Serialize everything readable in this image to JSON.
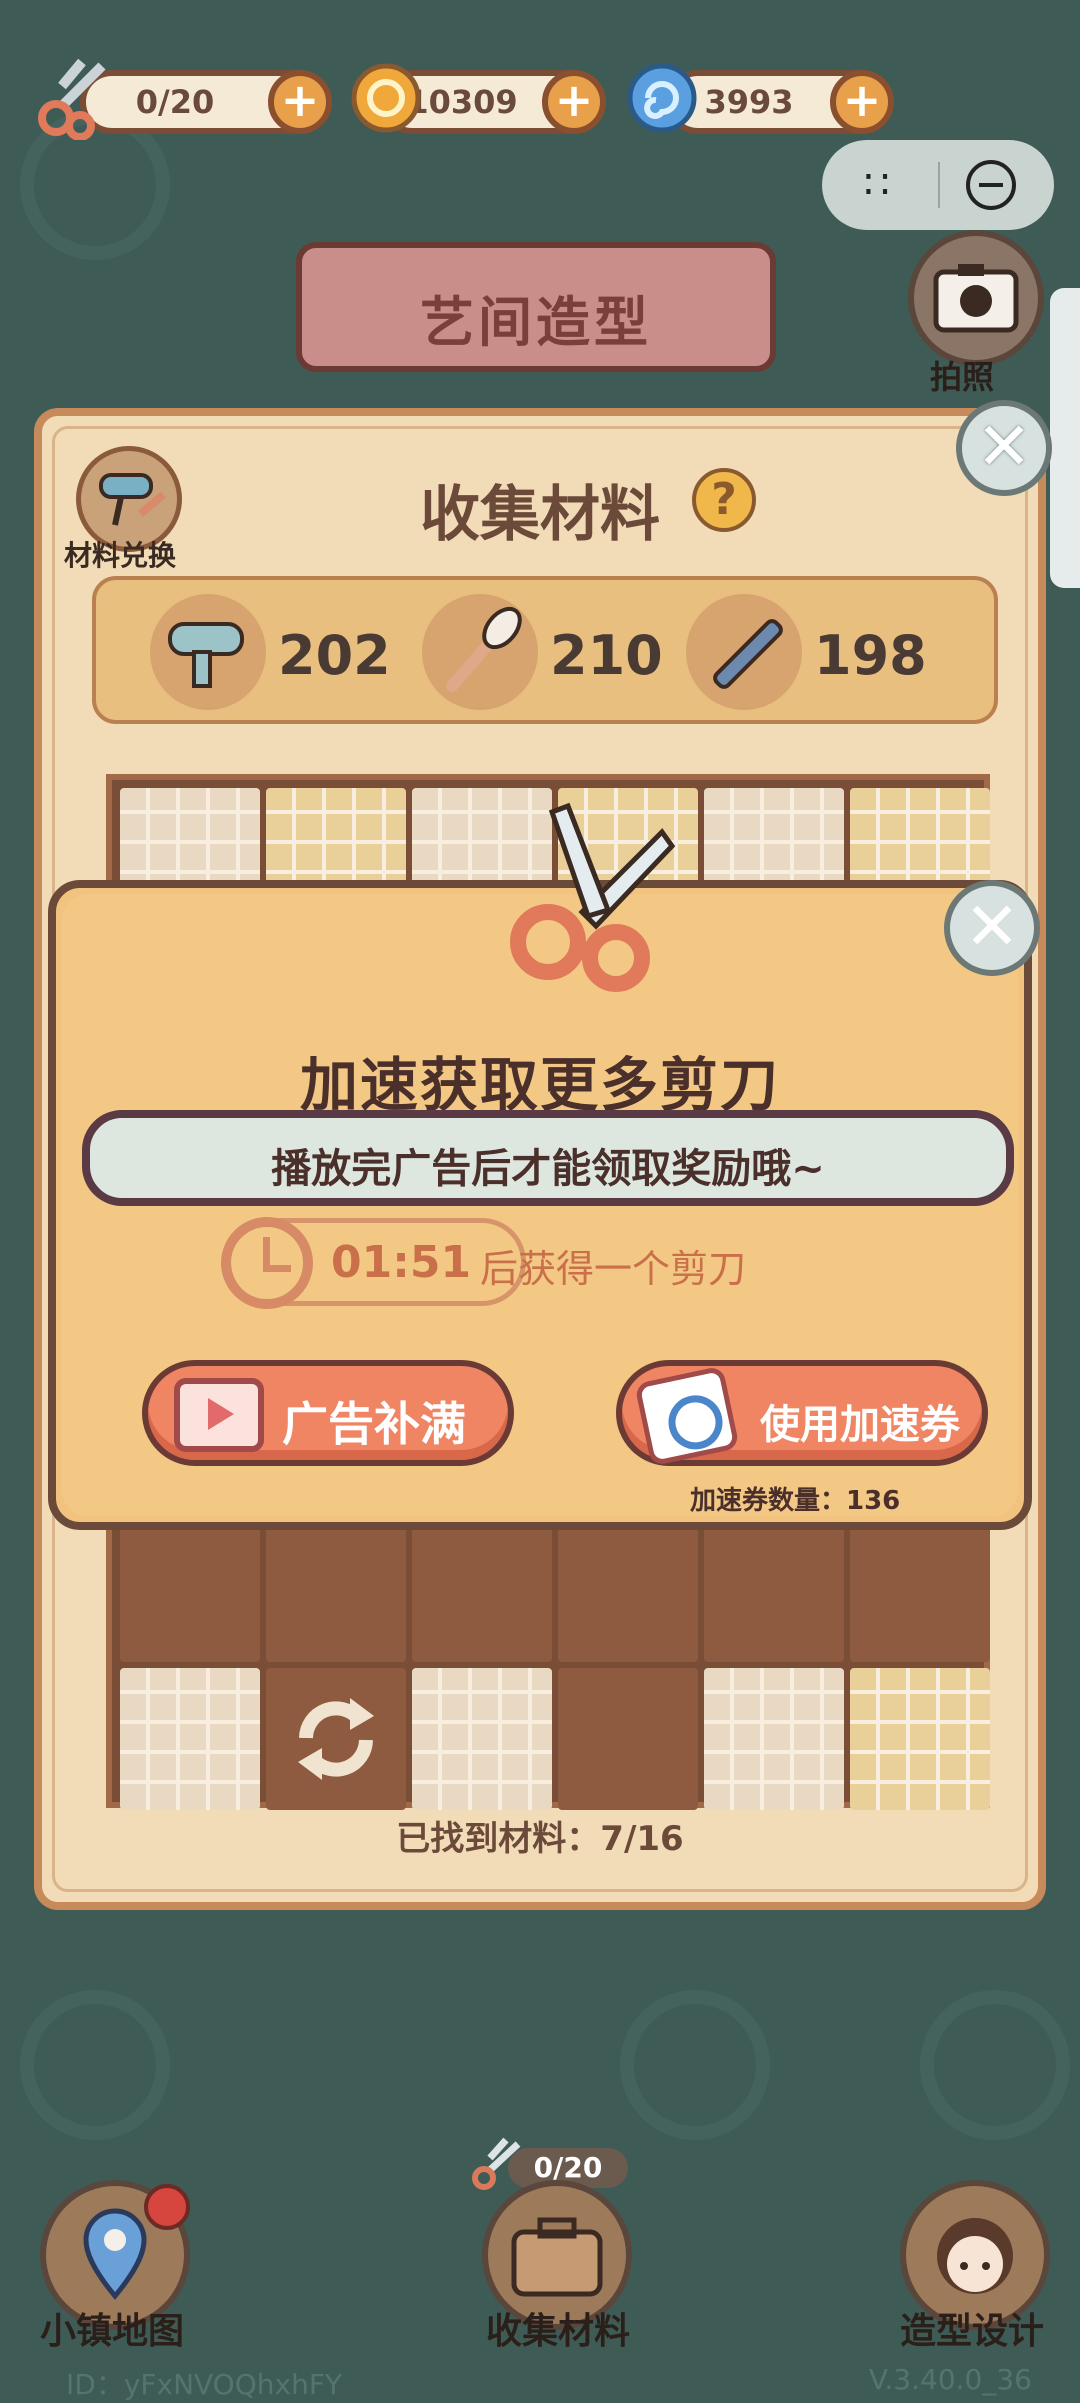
{
  "resources": [
    {
      "value": "0/20",
      "icon": "scissors-icon"
    },
    {
      "value": "10309",
      "icon": "coin-icon"
    },
    {
      "value": "3993",
      "icon": "swirl-gem-icon"
    }
  ],
  "banner": {
    "title": "艺间造型"
  },
  "camera": {
    "label": "拍照"
  },
  "panel": {
    "title": "收集材料",
    "exchange_label": "材料兑换",
    "materials": [
      {
        "icon": "hair-dryer-icon",
        "count": "202"
      },
      {
        "icon": "makeup-brush-icon",
        "count": "210"
      },
      {
        "icon": "comb-icon",
        "count": "198"
      }
    ],
    "found_text": "已找到材料：7/16"
  },
  "dialog": {
    "title": "加速获取更多剪刀",
    "notice": "播放完广告后才能领取奖励哦~",
    "timer": "01:51",
    "timer_suffix": "后获得一个剪刀",
    "ad_button": "广告补满",
    "speed_button": "使用加速券",
    "voucher_count": "加速券数量：136"
  },
  "nav": {
    "map_label": "小镇地图",
    "collect_label": "收集材料",
    "collect_badge": "0/20",
    "design_label": "造型设计"
  },
  "footer": {
    "uid": "ID：yFxNVOQhxhFY",
    "version": "V.3.40.0_36"
  },
  "colors": {
    "background": "#3e5a55",
    "panel": "#f2dcb8",
    "dialog": "#f1c37e",
    "button": "#f08564"
  }
}
